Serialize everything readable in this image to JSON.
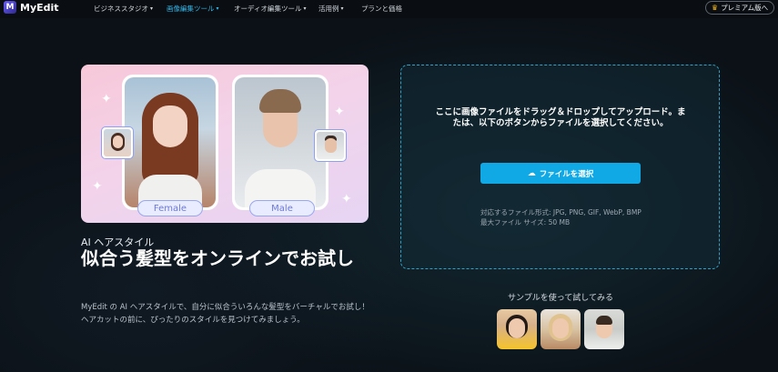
{
  "nav": {
    "logo_letter": "M",
    "logo_text": "MyEdit",
    "items": [
      {
        "label": "ビジネススタジオ"
      },
      {
        "label": "画像編集ツール"
      },
      {
        "label": "オーディオ編集ツール"
      },
      {
        "label": "活用例"
      },
      {
        "label": "プランと価格"
      }
    ],
    "premium_label": "プレミアム版へ"
  },
  "hero": {
    "female_label": "Female",
    "male_label": "Male"
  },
  "intro": {
    "subtitle": "AI ヘアスタイル",
    "title": "似合う髪型をオンラインでお試し",
    "description": "MyEdit の AI ヘアスタイルで、自分に似合ういろんな髪型をバーチャルでお試し！ヘアカットの前に、ぴったりのスタイルを見つけてみましょう。"
  },
  "upload": {
    "prompt": "ここに画像ファイルをドラッグ＆ドロップしてアップロード。または、以下のボタンからファイルを選択してください。",
    "button_label": "ファイルを選択",
    "formats": "対応するファイル形式: JPG, PNG, GIF, WebP, BMP",
    "max_size": "最大ファイル サイズ: 50 MB"
  },
  "samples": {
    "label": "サンプルを使って試してみる"
  },
  "colors": {
    "accent": "#10a9e6",
    "nav_active": "#33b6e8",
    "background": "#0b1117"
  }
}
